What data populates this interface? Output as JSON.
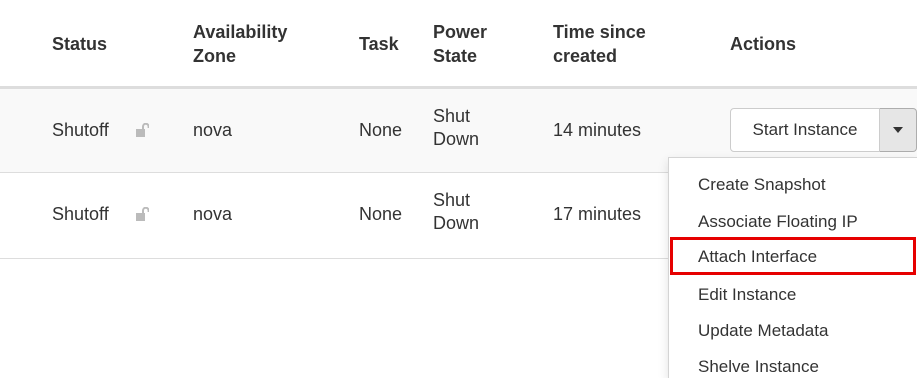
{
  "table": {
    "headers": {
      "status": "Status",
      "availability_zone_1": "Availability",
      "availability_zone_2": "Zone",
      "task": "Task",
      "power_state_1": "Power",
      "power_state_2": "State",
      "time_since_created_1": "Time since",
      "time_since_created_2": "created",
      "actions": "Actions"
    },
    "rows": [
      {
        "status": "Shutoff",
        "lock_icon": "unlocked-padlock-icon",
        "availability_zone": "nova",
        "task": "None",
        "power_state_1": "Shut",
        "power_state_2": "Down",
        "time_since_created": "14 minutes"
      },
      {
        "status": "Shutoff",
        "lock_icon": "unlocked-padlock-icon",
        "availability_zone": "nova",
        "task": "None",
        "power_state_1": "Shut",
        "power_state_2": "Down",
        "time_since_created": "17 minutes"
      }
    ]
  },
  "actions": {
    "primary_label": "Start Instance",
    "toggle_icon": "caret-down-icon"
  },
  "dropdown": {
    "items": [
      "Create Snapshot",
      "Associate Floating IP",
      "Attach Interface",
      "Edit Instance",
      "Update Metadata",
      "Shelve Instance"
    ],
    "highlighted_item": "Attach Interface",
    "highlight_color": "#e60000"
  }
}
